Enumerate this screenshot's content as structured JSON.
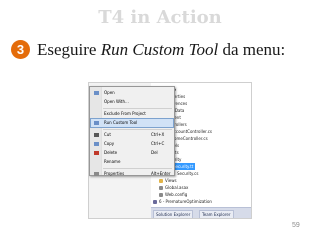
{
  "slide": {
    "title": "T4 in Action",
    "step_number": "3",
    "instruction_prefix": "Eseguire ",
    "instruction_emph": "Run Custom Tool",
    "instruction_suffix": " da menu:",
    "page_number": "59"
  },
  "context_menu": {
    "items": [
      {
        "label": "Open",
        "shortcut": ""
      },
      {
        "label": "Open With...",
        "shortcut": ""
      },
      {
        "label": "Exclude From Project",
        "shortcut": ""
      },
      {
        "label": "Run Custom Tool",
        "shortcut": ""
      },
      {
        "label": "Cut",
        "shortcut": "Ctrl+X"
      },
      {
        "label": "Copy",
        "shortcut": "Ctrl+C"
      },
      {
        "label": "Delete",
        "shortcut": "Del"
      },
      {
        "label": "Rename",
        "shortcut": ""
      },
      {
        "label": "Properties",
        "shortcut": "Alt+Enter"
      }
    ],
    "highlighted_index": 3
  },
  "solution_tree": {
    "items": [
      {
        "label": "T4-Web",
        "bold": true
      },
      {
        "label": "Properties"
      },
      {
        "label": "References"
      },
      {
        "label": "App_Data"
      },
      {
        "label": "Content"
      },
      {
        "label": "Controllers"
      },
      {
        "label": "AccountController.cs"
      },
      {
        "label": "HomeController.cs"
      },
      {
        "label": "Models"
      },
      {
        "label": "Scripts"
      },
      {
        "label": "Security"
      },
      {
        "label": "Security.tt",
        "selected": true
      },
      {
        "label": "Security.cs"
      },
      {
        "label": "Views"
      },
      {
        "label": "Global.asax"
      },
      {
        "label": "Web.config"
      },
      {
        "label": "6 - PrematureOptimization"
      }
    ]
  },
  "footer_tabs": [
    "Solution Explorer",
    "Team Explorer"
  ],
  "colors": {
    "accent": "#e46c0a",
    "title": "#d9d9d9",
    "selection": "#3399ff"
  }
}
